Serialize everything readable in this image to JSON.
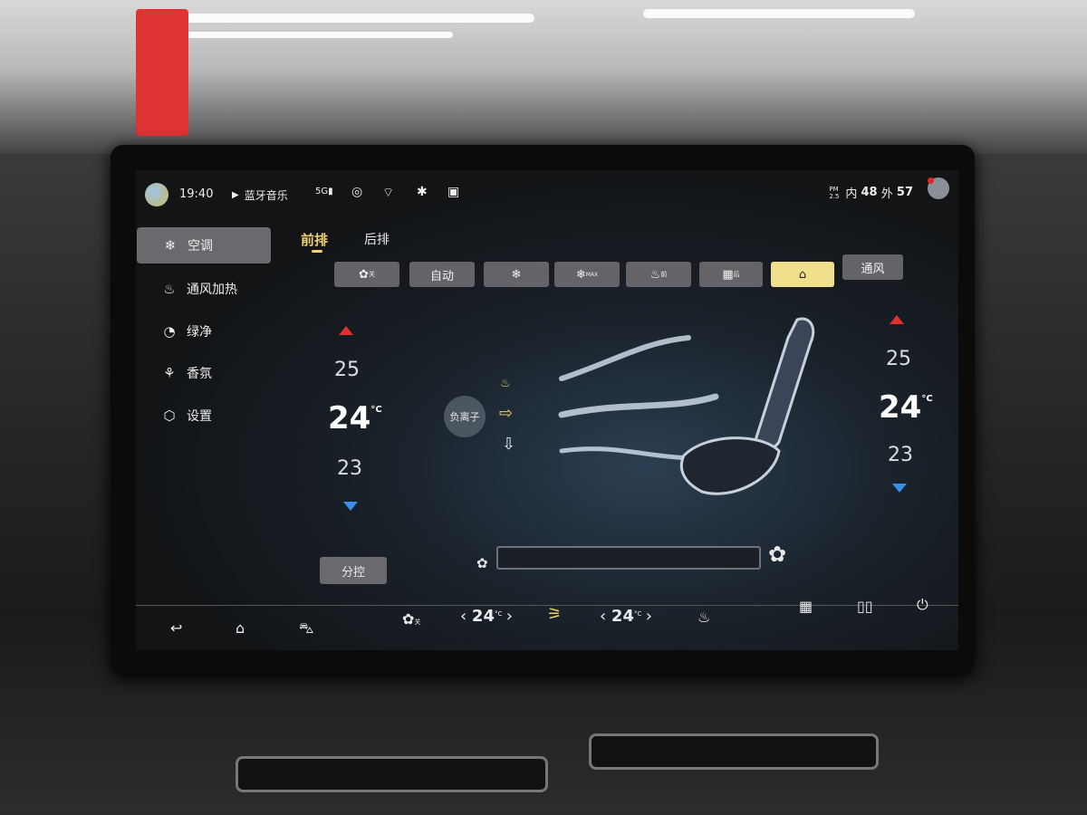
{
  "status_bar": {
    "time": "19:40",
    "media_label": "蓝牙音乐",
    "signal": "5G",
    "pm_label": "PM 2.5",
    "inside_label": "内",
    "inside_value": "48",
    "outside_label": "外",
    "outside_value": "57"
  },
  "sidebar": {
    "items": [
      {
        "label": "空调",
        "icon": "snowflake-icon",
        "active": true
      },
      {
        "label": "通风加热",
        "icon": "seat-heat-icon"
      },
      {
        "label": "绿净",
        "icon": "purify-icon"
      },
      {
        "label": "香氛",
        "icon": "fragrance-icon"
      },
      {
        "label": "设置",
        "icon": "hexagon-settings-icon"
      }
    ]
  },
  "tabs": [
    {
      "label": "前排",
      "active": true
    },
    {
      "label": "后排"
    }
  ],
  "modes": [
    {
      "label": "✿",
      "sub": "关"
    },
    {
      "label": "自动"
    },
    {
      "label": "❄"
    },
    {
      "label": "❄",
      "sub": "MAX"
    },
    {
      "label": "♨",
      "sub": "前"
    },
    {
      "label": "▦",
      "sub": "后"
    },
    {
      "label": "⌂",
      "active": true
    },
    {
      "label": "通风"
    }
  ],
  "left_zone": {
    "upper": "25",
    "current": "24",
    "lower": "23",
    "unit": "°C"
  },
  "right_zone": {
    "upper": "25",
    "current": "24",
    "lower": "23",
    "unit": "°C"
  },
  "ion_button": "负离子",
  "split_button": "分控",
  "fan_level": 0,
  "bottom_bar": {
    "fan_off": "关",
    "left_temp": "24",
    "right_temp": "24",
    "unit": "°C"
  },
  "colors": {
    "accent": "#f0e08c",
    "up_arrow": "#e0312e",
    "down_arrow": "#3a8fe8"
  }
}
